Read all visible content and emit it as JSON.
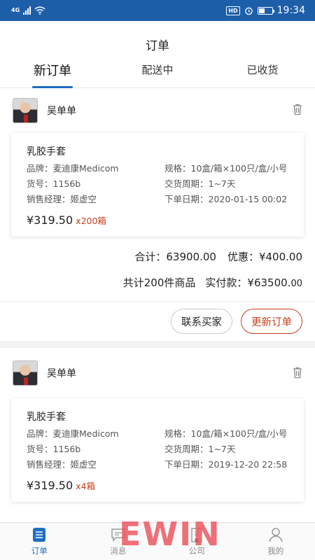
{
  "status_bar": {
    "network": "4G",
    "hd": "HD",
    "time": "19:34",
    "battery_level": 0.45,
    "icons": [
      "signal-icon",
      "wifi-icon",
      "alarm-icon",
      "battery-icon"
    ]
  },
  "header": {
    "title": "订单"
  },
  "tabs": [
    {
      "label": "新订单",
      "active": true
    },
    {
      "label": "配送中",
      "active": false
    },
    {
      "label": "已收货",
      "active": false
    }
  ],
  "orders": [
    {
      "buyer": "吴单单",
      "product": {
        "name": "乳胶手套",
        "brand": "品牌：麦迪康Medicom",
        "spec": "规格：10盒/箱×100只/盒/小号",
        "sku": "货号：1156b",
        "lead_time": "交货周期：1~7天",
        "manager": "销售经理：姬虚空",
        "order_date": "下单日期：2020-01-15 00:02",
        "price": "¥319.50",
        "qty": "x200箱"
      },
      "total": "合计：63900.00",
      "discount": "优惠：¥400.00",
      "count": "共计200件商品",
      "paid_label": "实付款：",
      "paid_int": "¥63500.",
      "paid_dec": "00",
      "contact_label": "联系买家",
      "update_label": "更新订单"
    },
    {
      "buyer": "吴单单",
      "product": {
        "name": "乳胶手套",
        "brand": "品牌：麦迪康Medicom",
        "spec": "规格：10盒/箱×100只/盒/小号",
        "sku": "货号：1156b",
        "lead_time": "交货周期：1~7天",
        "manager": "销售经理：姬虚空",
        "order_date": "下单日期：2019-12-20 22:58",
        "price": "¥319.50",
        "qty": "x4箱"
      }
    }
  ],
  "tabbar": [
    {
      "label": "订单",
      "icon": "order-icon",
      "active": true
    },
    {
      "label": "消息",
      "icon": "message-icon",
      "active": false
    },
    {
      "label": "公司",
      "icon": "company-icon",
      "active": false
    },
    {
      "label": "我的",
      "icon": "profile-icon",
      "active": false
    }
  ],
  "watermark": "EWIN",
  "colors": {
    "primary": "#1d6fc1",
    "status_bar": "#1d5ea8",
    "accent_red": "#c4401c"
  }
}
